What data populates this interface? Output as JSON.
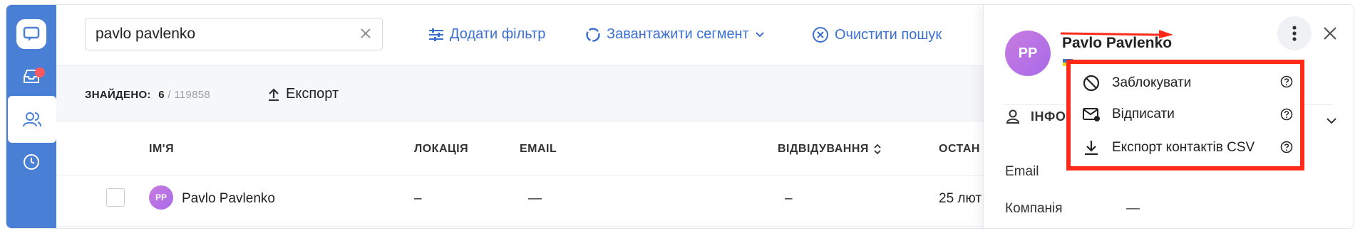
{
  "search": {
    "value": "pavlo pavlenko"
  },
  "toolbar": {
    "add_filter": "Додати фільтр",
    "load_segment": "Завантажити сегмент",
    "clear_search": "Очистити пошук"
  },
  "results": {
    "found_label": "ЗНАЙДЕНО:",
    "found_count": "6",
    "separator": "/",
    "total": "119858",
    "export_label": "Експорт"
  },
  "table": {
    "columns": [
      "ІМ'Я",
      "ЛОКАЦІЯ",
      "EMAIL",
      "ВІДВІДУВАННЯ",
      "ОСТАН"
    ],
    "rows": [
      {
        "initials": "PP",
        "name": "Pavlo Pavlenko",
        "location": "–",
        "email": "—",
        "visits": "–",
        "last": "25 лют"
      }
    ]
  },
  "panel": {
    "initials": "PP",
    "name": "Pavlo Pavlenko",
    "section_label": "ІНФО",
    "fields": [
      {
        "label": "Email",
        "value": ""
      },
      {
        "label": "Компанія",
        "value": "—"
      }
    ]
  },
  "menu": {
    "items": [
      {
        "label": "Заблокувати",
        "icon": "block-icon"
      },
      {
        "label": "Відписати",
        "icon": "unsubscribe-mail-icon"
      },
      {
        "label": "Експорт контактів CSV",
        "icon": "download-icon"
      }
    ]
  },
  "colors": {
    "sidebar": "#4a7fd6",
    "accent": "#3b6fd1",
    "highlight": "#ff2a1a",
    "avatar": "#b873e4",
    "badge": "#ff5a5f"
  }
}
